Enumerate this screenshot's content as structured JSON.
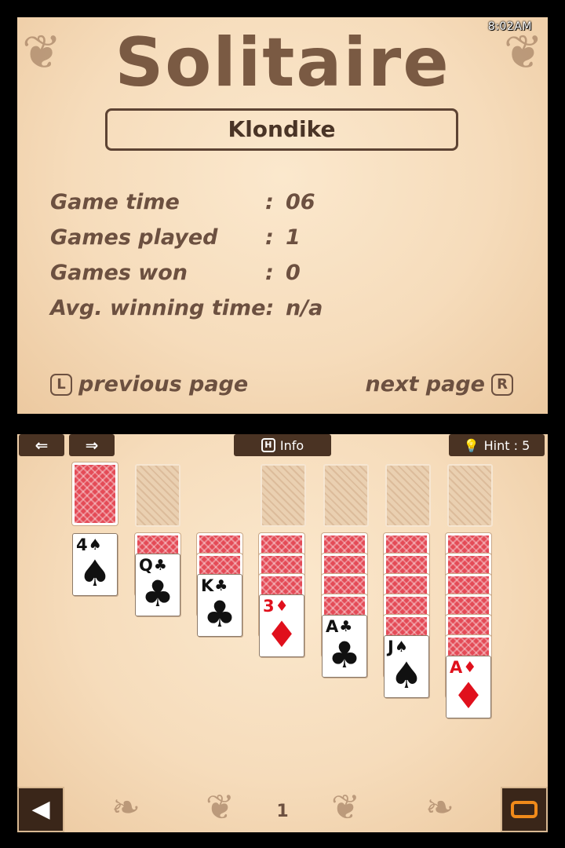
{
  "top": {
    "clock": "8:02AM",
    "title": "Solitaire",
    "mode": "Klondike",
    "stats": [
      {
        "label": "Game time",
        "value": "06"
      },
      {
        "label": "Games played",
        "value": "1"
      },
      {
        "label": "Games won",
        "value": "0"
      },
      {
        "label": "Avg. winning time:",
        "value": "n/a"
      }
    ],
    "prev_page": "previous page",
    "next_page": "next page",
    "prev_key": "L",
    "next_key": "R"
  },
  "toolbar": {
    "undo_glyph": "⇐",
    "redo_glyph": "⇒",
    "info_label": "Info",
    "info_key": "H",
    "hint_label": "Hint : 5"
  },
  "board": {
    "stock": "face-down",
    "foundations": [
      "empty",
      "empty",
      "empty",
      "empty"
    ],
    "waste": "empty",
    "tableau": [
      {
        "hidden": 0,
        "rank": "4",
        "suit": "♠",
        "color": "black"
      },
      {
        "hidden": 1,
        "rank": "Q",
        "suit": "♣",
        "color": "black"
      },
      {
        "hidden": 2,
        "rank": "K",
        "suit": "♣",
        "color": "black"
      },
      {
        "hidden": 3,
        "rank": "3",
        "suit": "♦",
        "color": "red"
      },
      {
        "hidden": 4,
        "rank": "A",
        "suit": "♣",
        "color": "black"
      },
      {
        "hidden": 5,
        "rank": "J",
        "suit": "♠",
        "color": "black"
      },
      {
        "hidden": 6,
        "rank": "A",
        "suit": "♦",
        "color": "red"
      }
    ]
  },
  "page_number": "1",
  "colors": {
    "card_back": "#e44b57",
    "toolbar": "#4a3323",
    "text": "#6c5040",
    "accent": "#f08a1a"
  }
}
